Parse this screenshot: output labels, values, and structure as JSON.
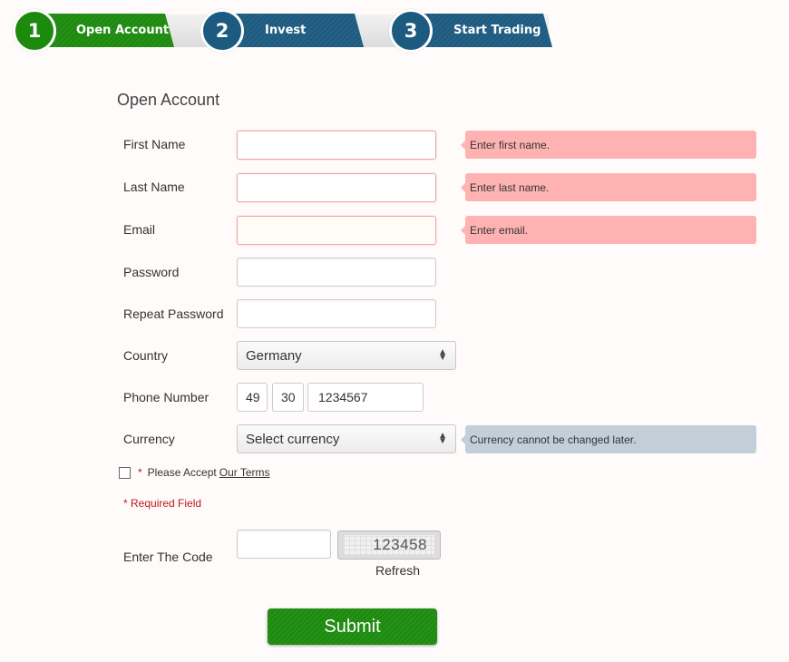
{
  "stepper": {
    "steps": [
      {
        "number": "1",
        "label": "Open Account",
        "state": "active",
        "color": "#1b8a0d"
      },
      {
        "number": "2",
        "label": "Invest",
        "state": "upcoming",
        "color": "#1c5a80"
      },
      {
        "number": "3",
        "label": "Start Trading",
        "state": "upcoming",
        "color": "#1c5a80"
      }
    ]
  },
  "form": {
    "title": "Open Account",
    "fields": {
      "first_name": {
        "label": "First Name",
        "value": "",
        "error": "Enter first name."
      },
      "last_name": {
        "label": "Last Name",
        "value": "",
        "error": "Enter last name."
      },
      "email": {
        "label": "Email",
        "value": "",
        "error": "Enter email."
      },
      "password": {
        "label": "Password",
        "value": ""
      },
      "repeat_password": {
        "label": "Repeat Password",
        "value": ""
      },
      "country": {
        "label": "Country",
        "selected": "Germany"
      },
      "phone": {
        "label": "Phone Number",
        "country_code": "49",
        "area_code": "30",
        "number": "1234567"
      },
      "currency": {
        "label": "Currency",
        "selected": "Select currency",
        "hint": "Currency cannot be changed later."
      }
    },
    "terms": {
      "required_marker": "*",
      "text": "Please Accept",
      "link": "Our Terms",
      "checked": false
    },
    "required_note": "* Required Field",
    "captcha": {
      "label": "Enter The Code",
      "value": "",
      "code": "123458",
      "refresh_label": "Refresh"
    },
    "submit_label": "Submit"
  },
  "colors": {
    "error_tip": "#ffb2b2",
    "info_tip": "#c2cfd8",
    "required": "#c0161b",
    "primary_green": "#1b8a0d",
    "step_blue": "#1c5a80"
  }
}
